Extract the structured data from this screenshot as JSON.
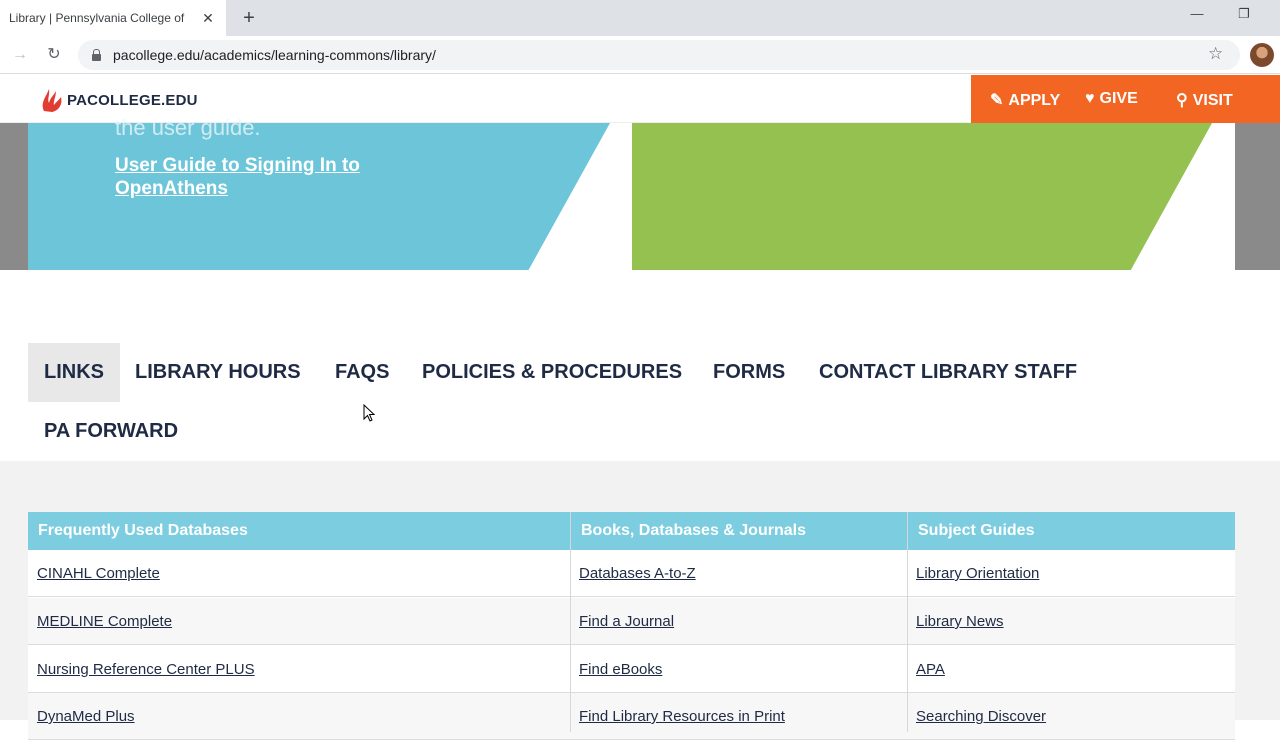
{
  "browser": {
    "tab_title": "Library | Pennsylvania College of",
    "url": "pacollege.edu/academics/learning-commons/library/"
  },
  "site": {
    "logo_text": "PACOLLEGE.EDU",
    "cta": {
      "apply": "APPLY",
      "give": "GIVE",
      "visit": "VISIT"
    },
    "colors": {
      "cta": "#f26522",
      "hero_blue": "#6cc5d9",
      "hero_green": "#94c150",
      "table_header": "#7ccde0"
    }
  },
  "hero": {
    "partial_text": "the user guide.",
    "link": "User Guide to Signing In to OpenAthens"
  },
  "tabs": [
    {
      "label": "LINKS",
      "active": true
    },
    {
      "label": "LIBRARY HOURS",
      "active": false
    },
    {
      "label": "FAQS",
      "active": false
    },
    {
      "label": "POLICIES & PROCEDURES",
      "active": false
    },
    {
      "label": "FORMS",
      "active": false
    },
    {
      "label": "CONTACT LIBRARY STAFF",
      "active": false
    },
    {
      "label": "PA FORWARD",
      "active": false
    }
  ],
  "table": {
    "headers": [
      "Frequently Used Databases",
      "Books, Databases & Journals",
      "Subject Guides"
    ],
    "rows": [
      [
        "CINAHL Complete",
        "Databases A-to-Z",
        "Library Orientation"
      ],
      [
        "MEDLINE Complete",
        "Find a Journal",
        "Library News"
      ],
      [
        "Nursing Reference Center PLUS",
        "Find eBooks",
        "APA"
      ],
      [
        "DynaMed Plus",
        "Find Library Resources in Print",
        "Searching Discover"
      ]
    ]
  }
}
